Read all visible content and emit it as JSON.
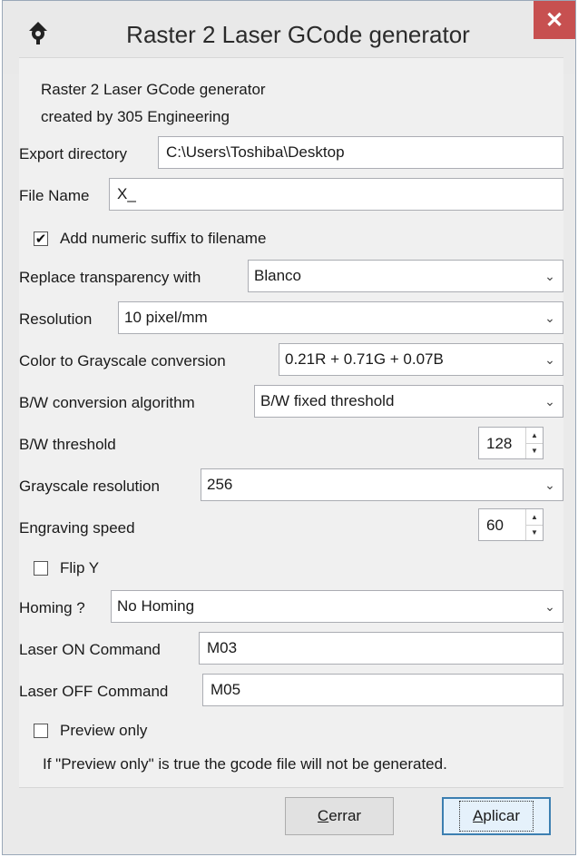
{
  "window": {
    "title": "Raster 2 Laser GCode generator",
    "close_glyph": "✕",
    "icon": "laser-app-icon"
  },
  "header": {
    "line1": "Raster 2 Laser GCode generator",
    "line2": "created by 305 Engineering"
  },
  "fields": {
    "export_directory": {
      "label": "Export directory",
      "value": "C:\\Users\\Toshiba\\Desktop"
    },
    "file_name": {
      "label": "File Name",
      "value": "X_"
    },
    "numeric_suffix": {
      "label": "Add numeric suffix to filename",
      "checked": true
    },
    "transparency": {
      "label": "Replace transparency with",
      "value": "Blanco"
    },
    "resolution": {
      "label": "Resolution",
      "value": "10 pixel/mm"
    },
    "grayscale_conversion": {
      "label": "Color to Grayscale conversion",
      "value": "0.21R + 0.71G + 0.07B"
    },
    "bw_algorithm": {
      "label": "B/W conversion algorithm",
      "value": "B/W fixed threshold"
    },
    "bw_threshold": {
      "label": "B/W threshold",
      "value": "128"
    },
    "grayscale_resolution": {
      "label": "Grayscale resolution",
      "value": "256"
    },
    "engraving_speed": {
      "label": "Engraving speed",
      "value": "60"
    },
    "flip_y": {
      "label": "Flip Y",
      "checked": false
    },
    "homing": {
      "label": "Homing ?",
      "value": "No Homing"
    },
    "laser_on": {
      "label": "Laser ON Command",
      "value": "M03"
    },
    "laser_off": {
      "label": "Laser OFF Command",
      "value": "M05"
    },
    "preview_only": {
      "label": "Preview only",
      "checked": false
    },
    "note": "If \"Preview only\" is true the gcode file will not be generated."
  },
  "buttons": {
    "close_accel": "C",
    "close_rest": "errar",
    "apply_accel": "A",
    "apply_rest": "plicar"
  },
  "glyphs": {
    "check": "✔",
    "dropdown": "⌄",
    "spin_up": "▲",
    "spin_down": "▼"
  }
}
